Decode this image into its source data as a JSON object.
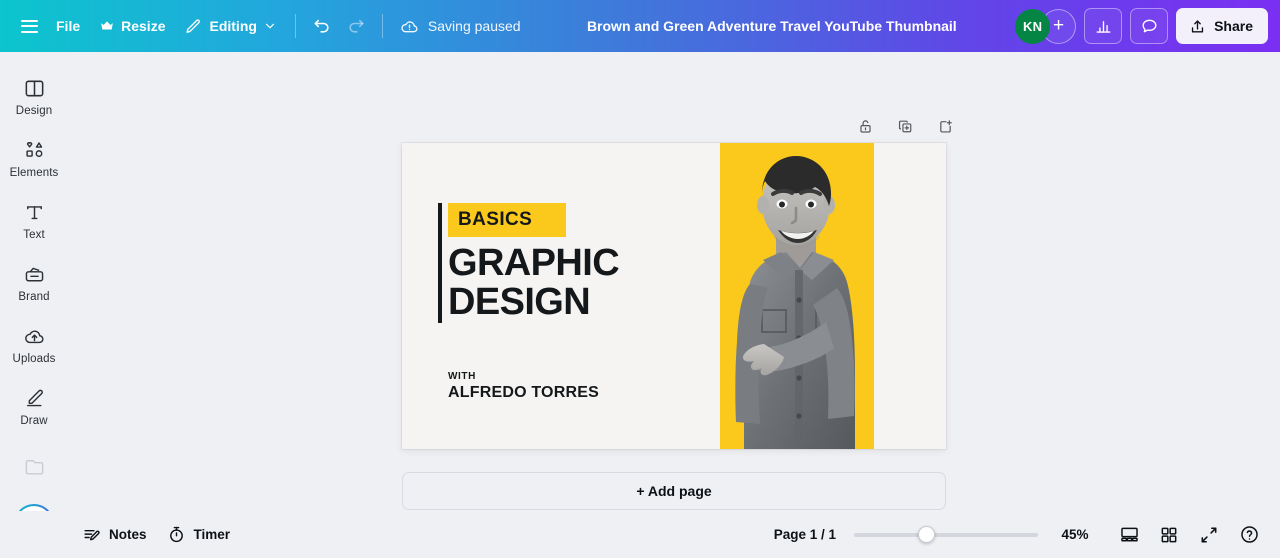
{
  "topbar": {
    "menu_icon": "hamburger-icon",
    "file_label": "File",
    "resize_label": "Resize",
    "resize_icon": "crown-icon",
    "editing_label": "Editing",
    "editing_icon": "pencil-icon",
    "editing_chevron": "chevron-down-icon",
    "undo_icon": "undo-arrow-icon",
    "redo_icon": "redo-arrow-icon",
    "saving_status": "Saving paused",
    "saving_icon": "cloud-alert-icon",
    "doc_title": "Brown and Green Adventure Travel YouTube Thumbnail",
    "avatar_initials": "KN",
    "avatar_color": "#048544",
    "add_collaborator": "+",
    "stats_icon": "bar-chart-icon",
    "comment_icon": "speech-bubble-icon",
    "share_label": "Share",
    "share_icon": "share-upload-icon",
    "gradient_start": "#0CC5CD",
    "gradient_mid": "#4077DA",
    "gradient_end": "#7B2FF2"
  },
  "sidebar": {
    "items": [
      {
        "label": "Design",
        "icon": "layout-panel-icon"
      },
      {
        "label": "Elements",
        "icon": "shapes-icon"
      },
      {
        "label": "Text",
        "icon": "text-t-icon"
      },
      {
        "label": "Brand",
        "icon": "brand-kit-icon"
      },
      {
        "label": "Uploads",
        "icon": "cloud-upload-icon"
      },
      {
        "label": "Draw",
        "icon": "pen-draw-icon"
      },
      {
        "label": "",
        "icon": "projects-folder-icon"
      }
    ],
    "magic_button_icon": "magic-sparkle-icon"
  },
  "page_tools": [
    {
      "name": "unlock-page",
      "icon": "open-padlock-icon"
    },
    {
      "name": "duplicate-page",
      "icon": "duplicate-icon"
    },
    {
      "name": "add-page",
      "icon": "add-page-icon"
    }
  ],
  "design": {
    "background_color": "#F5F4F2",
    "accent_color": "#FBC91B",
    "ink_color": "#15181B",
    "tag": "BASICS",
    "headline_line1": "GRAPHIC",
    "headline_line2": "DESIGN",
    "with_label": "WITH",
    "presenter": "ALFREDO TORRES",
    "photo_alt": "man-pointing-photo"
  },
  "add_page_button": "+ Add page",
  "bottombar": {
    "notes_label": "Notes",
    "notes_icon": "notes-pencil-icon",
    "timer_label": "Timer",
    "timer_icon": "stopwatch-icon",
    "page_count": "Page 1 / 1",
    "zoom_level": "45%",
    "zoom_slider_percent": 35,
    "presenter_view_icon": "presenter-view-icon",
    "grid_view_icon": "grid-view-icon",
    "fullscreen_icon": "expand-diagonal-icon",
    "help_icon": "question-circle-icon"
  }
}
